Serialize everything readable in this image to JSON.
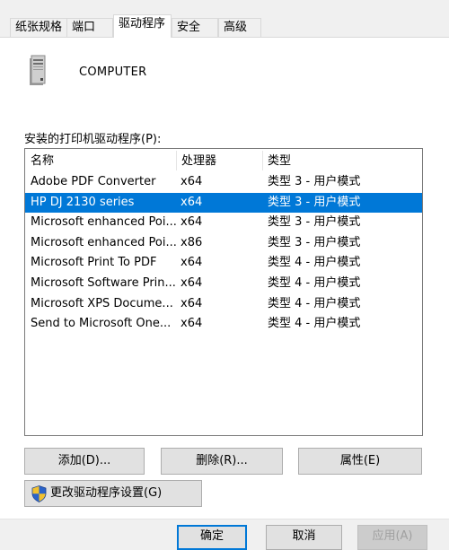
{
  "tabs": [
    {
      "label": "纸张规格"
    },
    {
      "label": "端口"
    },
    {
      "label": "驱动程序"
    },
    {
      "label": "安全"
    },
    {
      "label": "高级"
    }
  ],
  "active_tab": "驱动程序",
  "header": {
    "computer_icon": "computer-tower-icon",
    "computer_name": "COMPUTER"
  },
  "list": {
    "label": "安装的打印机驱动程序(P):",
    "columns": [
      "名称",
      "处理器",
      "类型"
    ],
    "rows": [
      {
        "name": "Adobe PDF Converter",
        "processor": "x64",
        "type": "类型 3 - 用户模式",
        "selected": false
      },
      {
        "name": "HP DJ 2130 series",
        "processor": "x64",
        "type": "类型 3 - 用户模式",
        "selected": true
      },
      {
        "name": "Microsoft enhanced Poi...",
        "processor": "x64",
        "type": "类型 3 - 用户模式",
        "selected": false
      },
      {
        "name": "Microsoft enhanced Poi...",
        "processor": "x86",
        "type": "类型 3 - 用户模式",
        "selected": false
      },
      {
        "name": "Microsoft Print To PDF",
        "processor": "x64",
        "type": "类型 4 - 用户模式",
        "selected": false
      },
      {
        "name": "Microsoft Software Prin...",
        "processor": "x64",
        "type": "类型 4 - 用户模式",
        "selected": false
      },
      {
        "name": "Microsoft XPS Docume...",
        "processor": "x64",
        "type": "类型 4 - 用户模式",
        "selected": false
      },
      {
        "name": "Send to Microsoft One...",
        "processor": "x64",
        "type": "类型 4 - 用户模式",
        "selected": false
      }
    ]
  },
  "buttons": {
    "add": "添加(D)...",
    "delete": "删除(R)...",
    "properties": "属性(E)",
    "change_settings": "更改驱动程序设置(G)",
    "ok": "确定",
    "cancel": "取消",
    "apply": "应用(A)"
  },
  "colors": {
    "selection": "#0078d7",
    "accent_border": "#0078d7"
  }
}
